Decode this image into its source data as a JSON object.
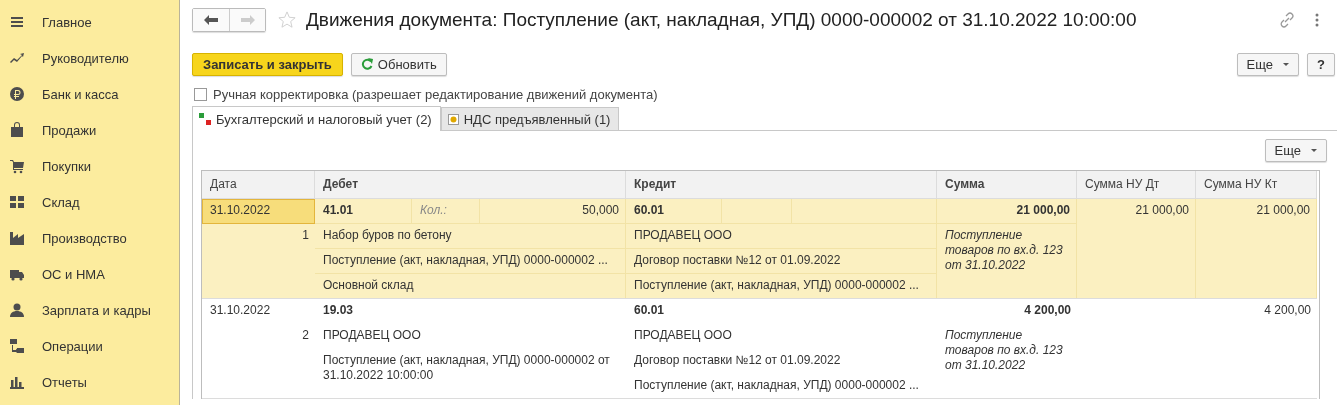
{
  "sidebar": {
    "items": [
      {
        "label": "Главное"
      },
      {
        "label": "Руководителю"
      },
      {
        "label": "Банк и касса"
      },
      {
        "label": "Продажи"
      },
      {
        "label": "Покупки"
      },
      {
        "label": "Склад"
      },
      {
        "label": "Производство"
      },
      {
        "label": "ОС и НМА"
      },
      {
        "label": "Зарплата и кадры"
      },
      {
        "label": "Операции"
      },
      {
        "label": "Отчеты"
      }
    ]
  },
  "header": {
    "title": "Движения документа: Поступление (акт, накладная, УПД) 0000-000002 от 31.10.2022 10:00:00"
  },
  "toolbar": {
    "buttons": [
      {
        "label": "Записать и закрыть",
        "kind": "primary"
      },
      {
        "label": "Обновить",
        "kind": "refresh"
      }
    ],
    "more": "Еще",
    "help": "?"
  },
  "manual_correction": {
    "label": "Ручная корректировка (разрешает редактирование движений документа)",
    "checked": false
  },
  "tabs": [
    {
      "label": "Бухгалтерский и налоговый учет (2)",
      "selected": true
    },
    {
      "label": "НДС предъявленный (1)",
      "selected": false
    }
  ],
  "table": {
    "more": "Еще",
    "columns": [
      "Дата",
      "Дебет",
      "Кредит",
      "Сумма",
      "Сумма НУ Дт",
      "Сумма НУ Кт"
    ],
    "rows": [
      {
        "selected": true,
        "focused": true,
        "date": "31.10.2022",
        "number": "1",
        "debit": {
          "account": "41.01",
          "qty_label": "Кол.:",
          "qty": "50,000",
          "lines": [
            "Набор буров по бетону",
            "Поступление (акт, накладная, УПД) 0000-000002 ...",
            "Основной склад"
          ]
        },
        "credit": {
          "account": "60.01",
          "lines": [
            "ПРОДАВЕЦ ООО",
            "Договор поставки №12 от 01.09.2022",
            "Поступление (акт, накладная, УПД) 0000-000002 ..."
          ]
        },
        "amount": "21 000,00",
        "amount_note": "Поступление товаров по вх.д. 123 от 31.10.2022",
        "nu_dt": "21 000,00",
        "nu_kt": "21 000,00"
      },
      {
        "selected": false,
        "focused": false,
        "date": "31.10.2022",
        "number": "2",
        "debit": {
          "account": "19.03",
          "lines": [
            "ПРОДАВЕЦ ООО",
            "Поступление (акт, накладная, УПД) 0000-000002 от 31.10.2022 10:00:00"
          ]
        },
        "credit": {
          "account": "60.01",
          "lines": [
            "ПРОДАВЕЦ ООО",
            "Договор поставки №12 от 01.09.2022",
            "Поступление (акт, накладная, УПД) 0000-000002 ..."
          ]
        },
        "amount": "4 200,00",
        "amount_note": "Поступление товаров по вх.д. 123 от 31.10.2022",
        "nu_kt": "4 200,00"
      }
    ]
  }
}
